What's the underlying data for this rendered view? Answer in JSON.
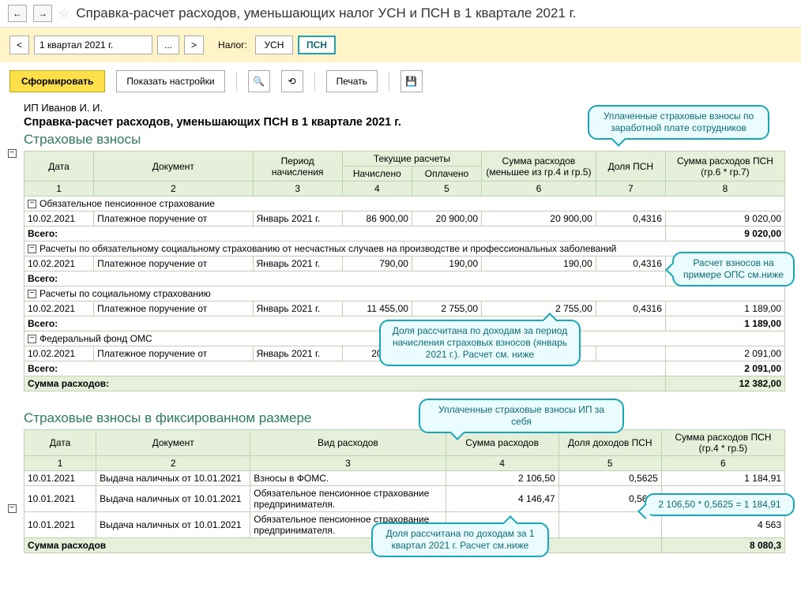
{
  "header": {
    "back": "←",
    "forward": "→",
    "star": "☆",
    "title": "Справка-расчет расходов, уменьшающих налог УСН и ПСН в 1 квартале 2021 г."
  },
  "period_bar": {
    "prev": "<",
    "period": "1 квартал 2021 г.",
    "ellipsis": "...",
    "next": ">",
    "tax_label": "Налог:",
    "tax_usn": "УСН",
    "tax_psn": "ПСН"
  },
  "toolbar": {
    "form": "Сформировать",
    "show_settings": "Показать настройки",
    "print": "Печать"
  },
  "report": {
    "ip": "ИП Иванов И. И.",
    "title": "Справка-расчет расходов, уменьшающих ПСН в 1 квартале 2021 г.",
    "section1": "Страховые взносы",
    "section2": "Страховые взносы в фиксированном размере",
    "sum_label": "Сумма расходов:",
    "sum_label2": "Сумма расходов",
    "total_label": "Всего:"
  },
  "t1_headers": {
    "c1": "Дата",
    "c2": "Документ",
    "c3": "Период начисления",
    "c4": "Текущие расчеты",
    "c4a": "Начислено",
    "c4b": "Оплачено",
    "c5": "Сумма расходов (меньшее из гр.4 и гр.5)",
    "c6": "Доля ПСН",
    "c7": "Сумма расходов ПСН (гр.6 * гр.7)",
    "n1": "1",
    "n2": "2",
    "n3": "3",
    "n4": "4",
    "n5": "5",
    "n6": "6",
    "n7": "7",
    "n8": "8"
  },
  "t1_groups": [
    {
      "name": "Обязательное пенсионное страхование",
      "rows": [
        {
          "date": "10.02.2021",
          "doc": "Платежное поручение от",
          "period": "Январь 2021 г.",
          "acc": "86 900,00",
          "paid": "20 900,00",
          "exp": "20 900,00",
          "share": "0,4316",
          "psn": "9 020,00"
        }
      ],
      "total": "9 020,00"
    },
    {
      "name": "Расчеты по обязательному социальному страхованию от несчастных случаев на производстве и профессиональных заболеваний",
      "rows": [
        {
          "date": "10.02.2021",
          "doc": "Платежное поручение от",
          "period": "Январь 2021 г.",
          "acc": "790,00",
          "paid": "190,00",
          "exp": "190,00",
          "share": "0,4316",
          "psn": ""
        }
      ],
      "total": ""
    },
    {
      "name": "Расчеты по социальному страхованию",
      "rows": [
        {
          "date": "10.02.2021",
          "doc": "Платежное поручение от",
          "period": "Январь 2021 г.",
          "acc": "11 455,00",
          "paid": "2 755,00",
          "exp": "2 755,00",
          "share": "0,4316",
          "psn": "1 189,00"
        }
      ],
      "total": "1 189,00"
    },
    {
      "name": "Федеральный фонд ОМС",
      "rows": [
        {
          "date": "10.02.2021",
          "doc": "Платежное поручение от",
          "period": "Январь 2021 г.",
          "acc": "20 145,0",
          "paid": "",
          "exp": "",
          "share": "",
          "psn": "2 091,00"
        }
      ],
      "total": "2 091,00"
    }
  ],
  "t1_sum": "12 382,00",
  "t2_headers": {
    "c1": "Дата",
    "c2": "Документ",
    "c3": "Вид расходов",
    "c4": "Сумма расходов",
    "c5": "Доля доходов ПСН",
    "c6": "Сумма расходов ПСН (гр.4 * гр.5)",
    "n1": "1",
    "n2": "2",
    "n3": "3",
    "n4": "4",
    "n5": "5",
    "n6": "6"
  },
  "t2_rows": [
    {
      "date": "10.01.2021",
      "doc": "Выдача наличных  от 10.01.2021",
      "kind": "Взносы в ФОМС.",
      "sum": "2 106,50",
      "share": "0,5625",
      "psn": "1 184,91"
    },
    {
      "date": "10.01.2021",
      "doc": "Выдача наличных  от 10.01.2021",
      "kind": "Обязательное пенсионное страхование предпринимателя.",
      "sum": "4 146,47",
      "share": "0,5625",
      "psn": ""
    },
    {
      "date": "10.01.2021",
      "doc": "Выдача наличных  от 10.01.2021",
      "kind": "Обязательное пенсионное страхование предпринимателя.",
      "sum": "",
      "share": "",
      "psn": "4 563"
    }
  ],
  "t2_sum": "8 080,3",
  "callouts": {
    "c1": "Уплаченные страховые взносы по заработной плате сотрудников",
    "c2": "Расчет взносов на примере ОПС см.ниже",
    "c3": "Доля рассчитана по доходам за период начисления страховых взносов (январь 2021 г.). Расчет см. ниже",
    "c4": "Уплаченные страховые взносы ИП за себя",
    "c5": "2 106,50 * 0,5625 = 1 184,91",
    "c6": "Доля рассчитана по доходам за 1 квартал 2021 г. Расчет см.ниже"
  }
}
